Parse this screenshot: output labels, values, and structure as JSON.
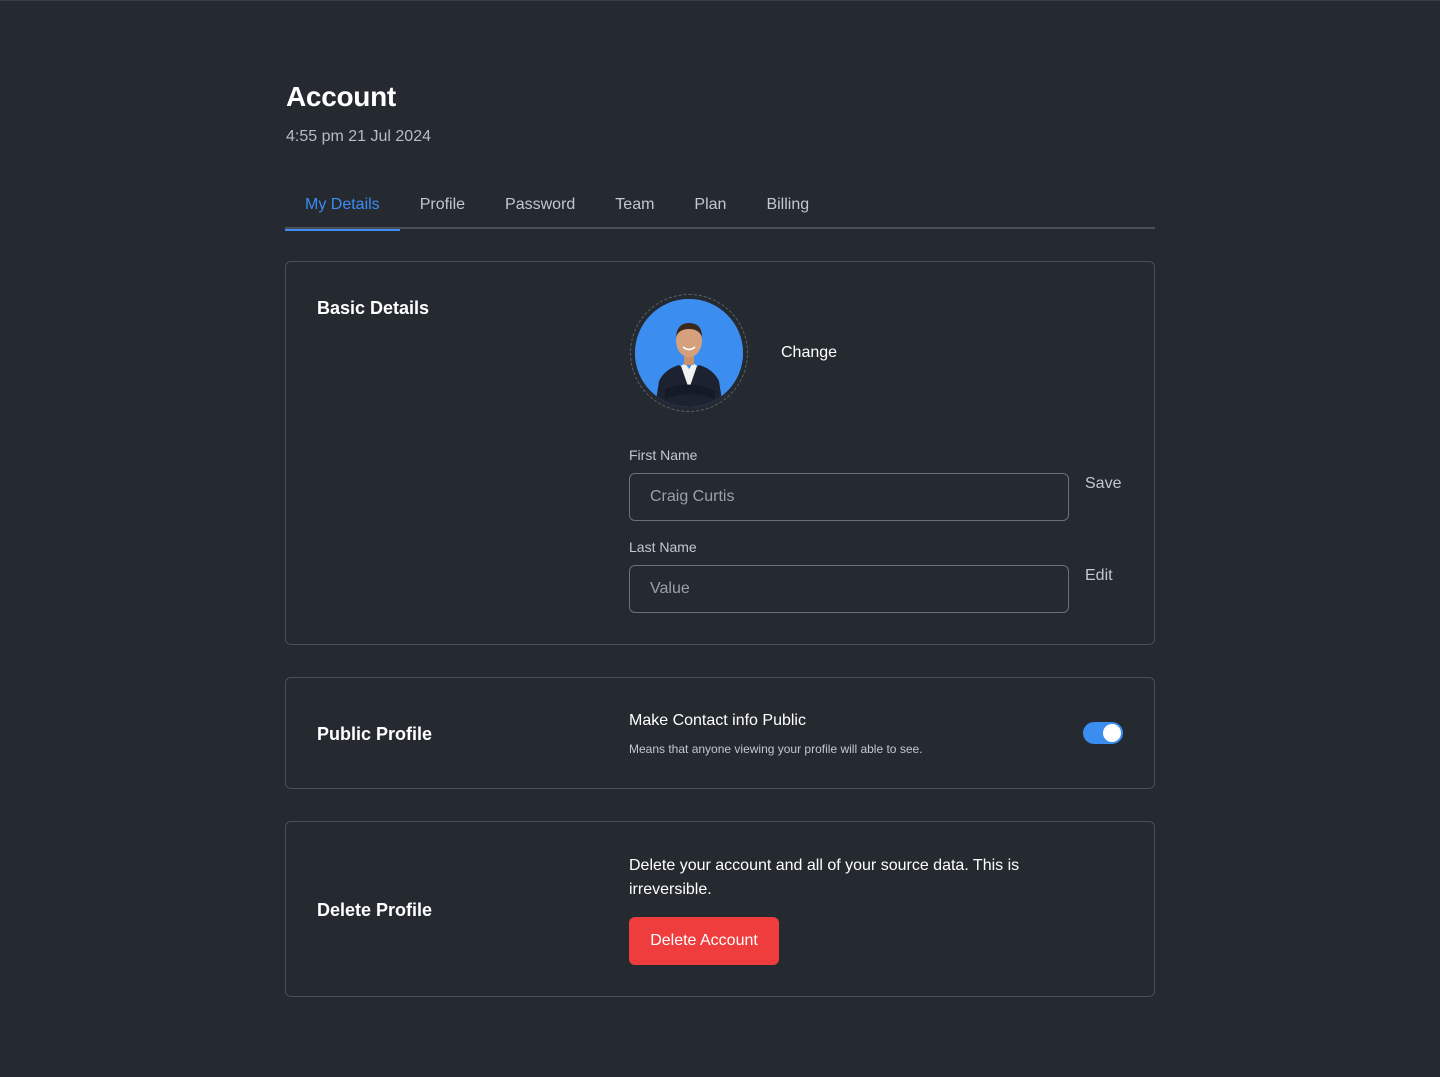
{
  "header": {
    "title": "Account",
    "timestamp": "4:55 pm 21 Jul 2024"
  },
  "tabs": [
    {
      "label": "My Details",
      "active": true
    },
    {
      "label": "Profile",
      "active": false
    },
    {
      "label": "Password",
      "active": false
    },
    {
      "label": "Team",
      "active": false
    },
    {
      "label": "Plan",
      "active": false
    },
    {
      "label": "Billing",
      "active": false
    }
  ],
  "basic_details": {
    "title": "Basic Details",
    "change_label": "Change",
    "first_name": {
      "label": "First Name",
      "value": "Craig Curtis",
      "action": "Save"
    },
    "last_name": {
      "label": "Last Name",
      "placeholder": "Value",
      "action": "Edit"
    }
  },
  "public_profile": {
    "title": "Public Profile",
    "toggle_title": "Make Contact info Public",
    "toggle_description": "Means that anyone viewing your profile will able to see.",
    "toggle_on": true
  },
  "delete_profile": {
    "title": "Delete Profile",
    "description": "Delete your account and all of your source data. This is irreversible.",
    "button_label": "Delete Account"
  },
  "colors": {
    "background": "#252a31",
    "accent": "#3d8bf2",
    "danger": "#ef3c3c",
    "border": "#4a4f57"
  }
}
